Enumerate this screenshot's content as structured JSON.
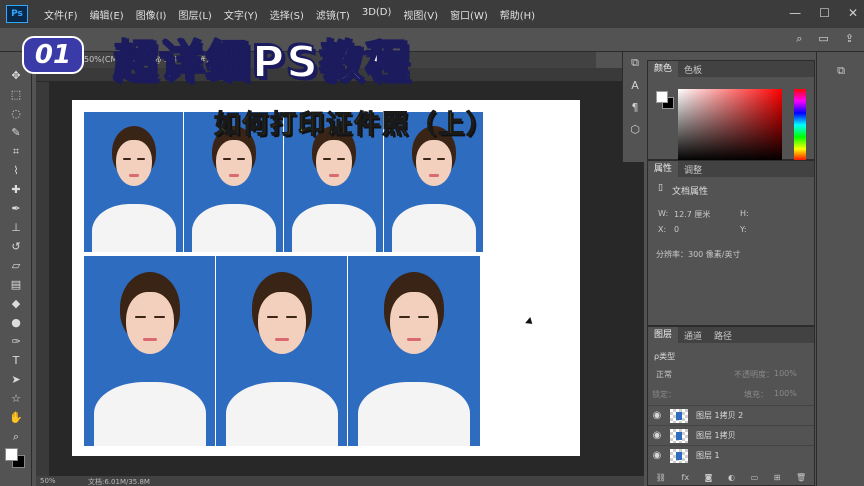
{
  "menu": {
    "logo": "Ps",
    "items": [
      "文件(F)",
      "编辑(E)",
      "图像(I)",
      "图层(L)",
      "文字(Y)",
      "选择(S)",
      "滤镜(T)",
      "3D(D)",
      "视图(V)",
      "窗口(W)",
      "帮助(H)"
    ],
    "minimize": "—",
    "maximize": "☐",
    "close": "✕"
  },
  "overlay": {
    "badge": "01",
    "title": "超详细PS教程",
    "subtitle": "如何打印证件照（上）"
  },
  "document": {
    "tab_text": "50%(CMY... 4.jpg @ ... RGB/8#)",
    "zoom": "50%",
    "doc_size": "文档:6.01M/35.8M"
  },
  "panels": {
    "color": {
      "tabs": [
        "颜色",
        "色板"
      ]
    },
    "properties": {
      "tabs": [
        "属性",
        "调整"
      ],
      "section": "文档属性",
      "w_label": "W:",
      "w_value": "12.7 厘米",
      "h_label": "H:",
      "x_label": "X:",
      "x_value": "0",
      "y_label": "Y:",
      "resolution": "分辨率：300 像素/英寸"
    },
    "layers": {
      "tabs": [
        "图层",
        "通道",
        "路径"
      ],
      "filter": "ρ类型",
      "blend_mode": "正常",
      "opacity_label": "不透明度：",
      "opacity_value": "100%",
      "lock_label": "锁定：",
      "fill_label": "填充：",
      "fill_value": "100%",
      "items": [
        {
          "name": "图层 1拷贝 2"
        },
        {
          "name": "图层 1拷贝"
        },
        {
          "name": "图层 1"
        }
      ]
    }
  },
  "colors": {
    "photo_background": "#2e6cc0",
    "title_color": "#ffffff",
    "subtitle_color": "#f8e020",
    "badge_color": "#3a3aa8"
  },
  "toolbar": {
    "tools": [
      "move-tool",
      "marquee-tool",
      "lasso-tool",
      "quick-select-tool",
      "crop-tool",
      "eyedropper-tool",
      "healing-brush-tool",
      "brush-tool",
      "clone-stamp-tool",
      "history-brush-tool",
      "eraser-tool",
      "gradient-tool",
      "blur-tool",
      "dodge-tool",
      "pen-tool",
      "type-tool",
      "path-select-tool",
      "shape-tool",
      "hand-tool",
      "zoom-tool"
    ]
  }
}
